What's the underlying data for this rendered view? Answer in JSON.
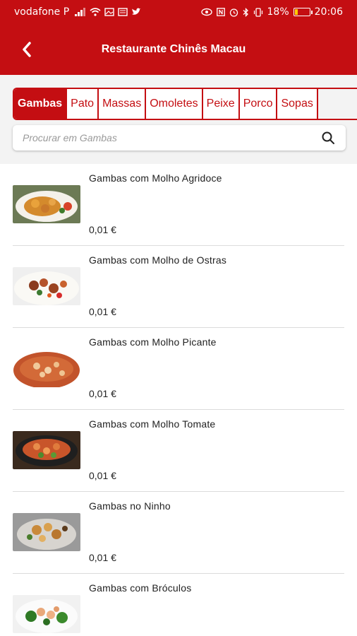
{
  "status_bar": {
    "carrier": "vodafone P",
    "battery": "18%",
    "time": "20:06",
    "battery_level": 0.18
  },
  "app_bar": {
    "title": "Restaurante Chinês Macau",
    "back_icon": "chevron-left-icon"
  },
  "tabs": [
    {
      "label": "Gambas",
      "active": true
    },
    {
      "label": "Pato",
      "active": false
    },
    {
      "label": "Massas",
      "active": false
    },
    {
      "label": "Omoletes",
      "active": false
    },
    {
      "label": "Peixe",
      "active": false
    },
    {
      "label": "Porco",
      "active": false
    },
    {
      "label": "Sopas",
      "active": false
    }
  ],
  "search": {
    "placeholder": "Procurar em Gambas",
    "icon": "search-icon"
  },
  "items": [
    {
      "name": "Gambas com Molho Agridoce",
      "price": "0,01 €"
    },
    {
      "name": "Gambas com Molho de Ostras",
      "price": "0,01 €"
    },
    {
      "name": "Gambas com Molho Picante",
      "price": "0,01 €"
    },
    {
      "name": "Gambas com Molho Tomate",
      "price": "0,01 €"
    },
    {
      "name": "Gambas no Ninho",
      "price": "0,01 €"
    },
    {
      "name": "Gambas com Bróculos",
      "price": ""
    }
  ],
  "colors": {
    "brand": "#c40e12",
    "tab_background": "#f3f3f3"
  }
}
